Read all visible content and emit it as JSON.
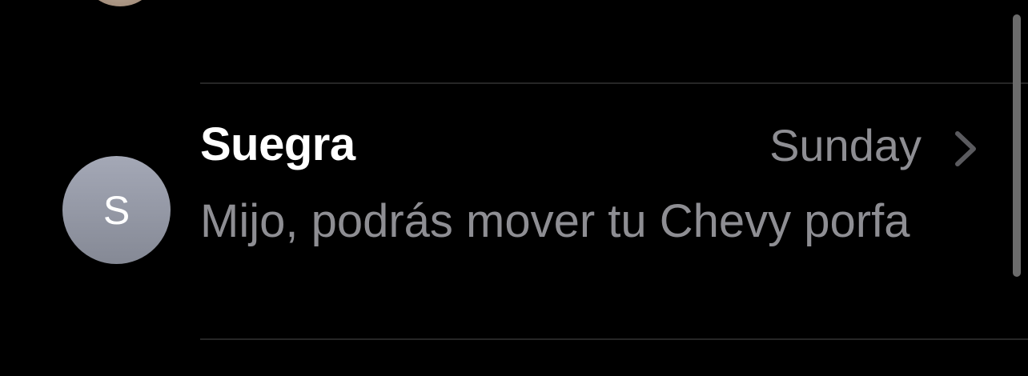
{
  "conversation": {
    "avatar_initial": "S",
    "name": "Suegra",
    "timestamp": "Sunday",
    "preview": "Mijo, podrás mover tu Chevy porfa",
    "chevron_icon": "chevron-right-icon"
  },
  "colors": {
    "background": "#000000",
    "primary_text": "#ffffff",
    "secondary_text": "#8e8e93",
    "avatar_fill": "#9a9ea9",
    "divider": "#262626"
  }
}
